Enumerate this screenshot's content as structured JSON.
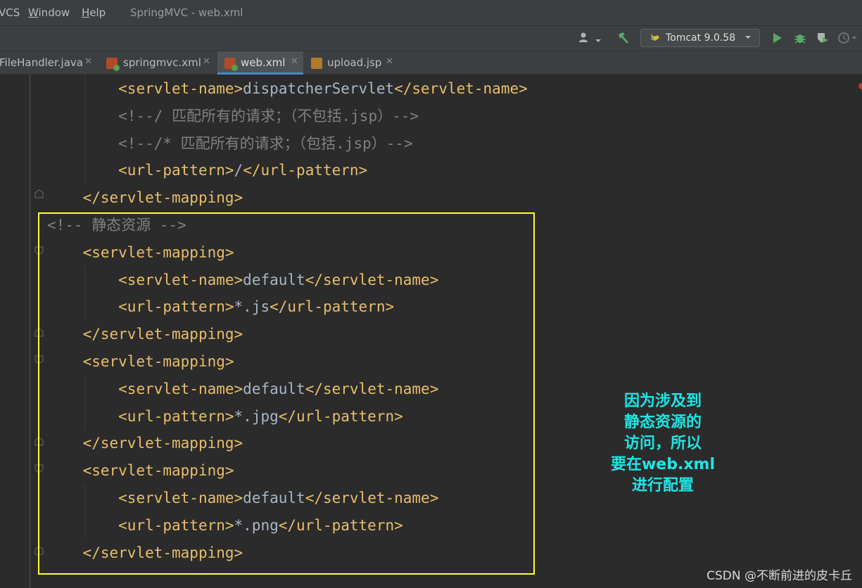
{
  "menu": {
    "items": [
      "VCS",
      "Window",
      "Help"
    ],
    "window_title": "SpringMVC - web.xml"
  },
  "toolbar": {
    "icons": [
      "user-icon",
      "chevron-down-icon",
      "hammer-icon",
      "run-icon",
      "debug-icon",
      "coverage-icon",
      "profile-icon"
    ],
    "run_config_label": "Tomcat 9.0.58"
  },
  "tabs": [
    {
      "label": "FileHandler.java",
      "active": false
    },
    {
      "label": "springmvc.xml",
      "active": false
    },
    {
      "label": "web.xml",
      "active": true
    },
    {
      "label": "upload.jsp",
      "active": false
    }
  ],
  "code": {
    "lines": [
      {
        "indent": "        ",
        "parts": [
          [
            "tag",
            "<servlet-name>"
          ],
          [
            "val",
            "dispatcherServlet"
          ],
          [
            "tag",
            "</servlet-name>"
          ]
        ]
      },
      {
        "indent": "        ",
        "parts": [
          [
            "cmt",
            "<!--/ 匹配所有的请求；（不包括.jsp）-->"
          ]
        ]
      },
      {
        "indent": "        ",
        "parts": [
          [
            "cmt",
            "<!--/* 匹配所有的请求；（包括.jsp）-->"
          ]
        ]
      },
      {
        "indent": "        ",
        "parts": [
          [
            "tag",
            "<url-pattern>"
          ],
          [
            "val",
            "/"
          ],
          [
            "tag",
            "</url-pattern>"
          ]
        ]
      },
      {
        "indent": "    ",
        "parts": [
          [
            "tag",
            "</servlet-mapping>"
          ]
        ]
      },
      {
        "indent": "",
        "parts": [
          [
            "cmt",
            "<!-- 静态资源 -->"
          ]
        ]
      },
      {
        "indent": "    ",
        "parts": [
          [
            "tag",
            "<servlet-mapping>"
          ]
        ]
      },
      {
        "indent": "        ",
        "parts": [
          [
            "tag",
            "<servlet-name>"
          ],
          [
            "val",
            "default"
          ],
          [
            "tag",
            "</servlet-name>"
          ]
        ]
      },
      {
        "indent": "        ",
        "parts": [
          [
            "tag",
            "<url-pattern>"
          ],
          [
            "val",
            "*.js"
          ],
          [
            "tag",
            "</url-pattern>"
          ]
        ]
      },
      {
        "indent": "    ",
        "parts": [
          [
            "tag",
            "</servlet-mapping>"
          ]
        ]
      },
      {
        "indent": "    ",
        "parts": [
          [
            "tag",
            "<servlet-mapping>"
          ]
        ]
      },
      {
        "indent": "        ",
        "parts": [
          [
            "tag",
            "<servlet-name>"
          ],
          [
            "val",
            "default"
          ],
          [
            "tag",
            "</servlet-name>"
          ]
        ]
      },
      {
        "indent": "        ",
        "parts": [
          [
            "tag",
            "<url-pattern>"
          ],
          [
            "val",
            "*.jpg"
          ],
          [
            "tag",
            "</url-pattern>"
          ]
        ]
      },
      {
        "indent": "    ",
        "parts": [
          [
            "tag",
            "</servlet-mapping>"
          ]
        ]
      },
      {
        "indent": "    ",
        "parts": [
          [
            "tag",
            "<servlet-mapping>"
          ]
        ]
      },
      {
        "indent": "        ",
        "parts": [
          [
            "tag",
            "<servlet-name>"
          ],
          [
            "val",
            "default"
          ],
          [
            "tag",
            "</servlet-name>"
          ]
        ]
      },
      {
        "indent": "        ",
        "parts": [
          [
            "tag",
            "<url-pattern>"
          ],
          [
            "val",
            "*.png"
          ],
          [
            "tag",
            "</url-pattern>"
          ]
        ]
      },
      {
        "indent": "    ",
        "parts": [
          [
            "tag",
            "</servlet-mapping>"
          ]
        ]
      }
    ]
  },
  "annotation": {
    "lines": [
      "因为涉及到",
      "静态资源的",
      "访问，所以",
      "要在web.xml",
      "进行配置"
    ]
  },
  "watermark": "CSDN @不断前进的皮卡丘",
  "colors": {
    "tag": "#e8bf6a",
    "comment": "#808080",
    "text": "#a9b7c6",
    "highlight_box": "#ffff33",
    "annotation": "#1ee5e5"
  }
}
